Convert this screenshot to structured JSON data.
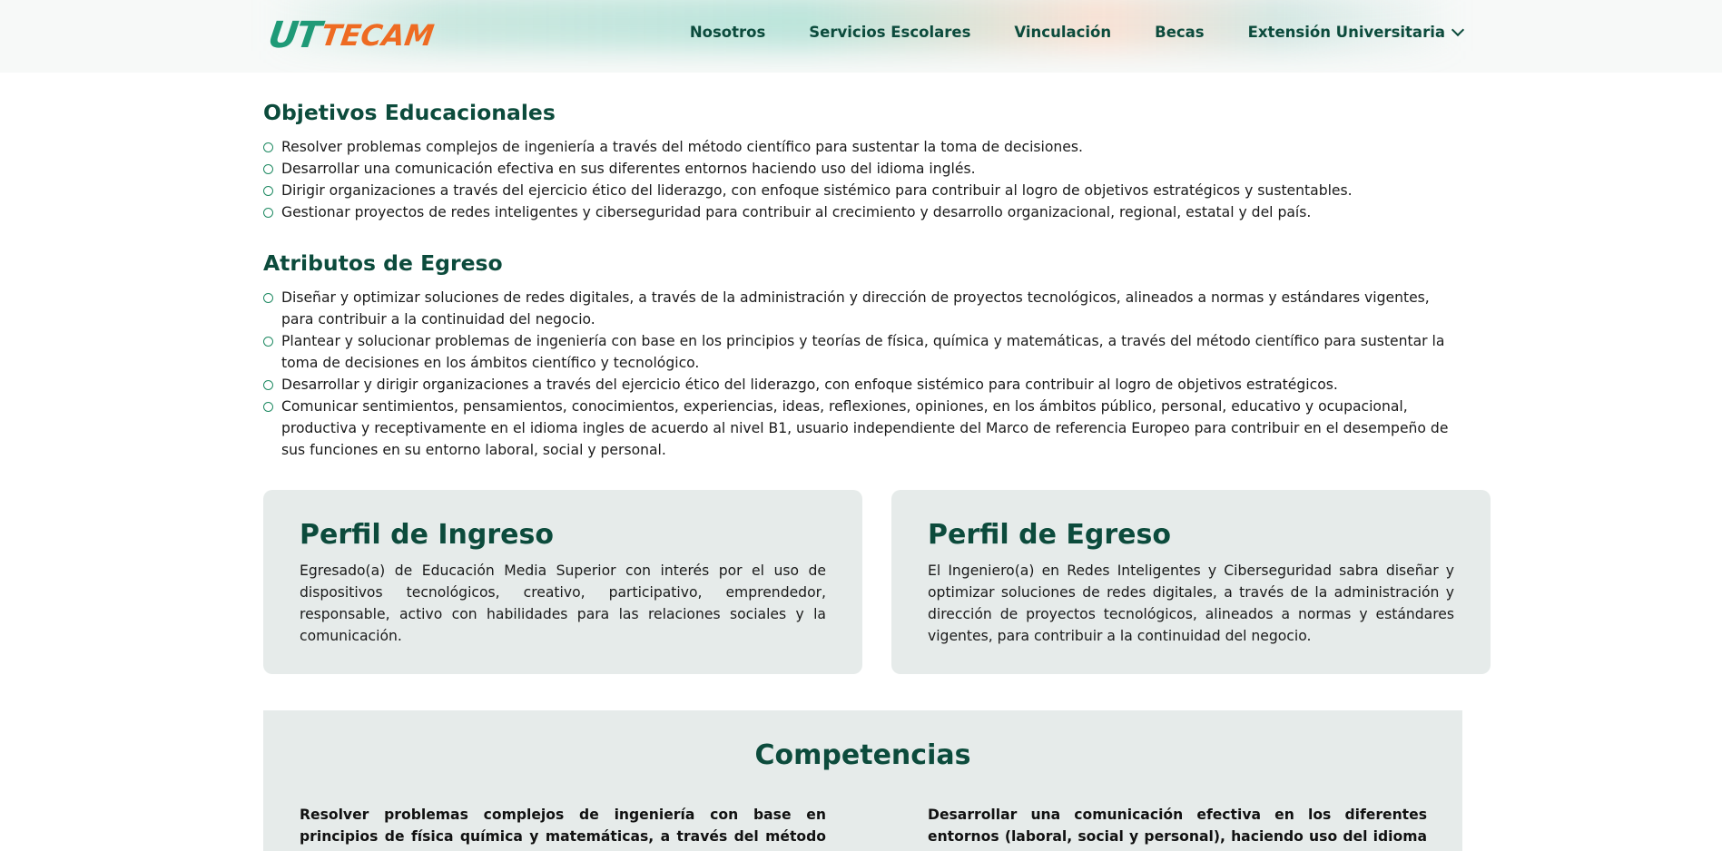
{
  "header": {
    "logo": {
      "part1": "UT",
      "part2": "TECAM"
    },
    "nav": [
      {
        "label": "Nosotros"
      },
      {
        "label": "Servicios Escolares"
      },
      {
        "label": "Vinculación"
      },
      {
        "label": "Becas"
      },
      {
        "label": "Extensión Universitaria",
        "has_dropdown": true
      }
    ]
  },
  "objetivos": {
    "title": "Objetivos Educacionales",
    "items": [
      "Resolver problemas complejos de ingeniería a través del método científico para sustentar la toma de decisiones.",
      "Desarrollar una comunicación efectiva en sus diferentes entornos haciendo uso del idioma inglés.",
      "Dirigir organizaciones a través del ejercicio ético del liderazgo, con enfoque sistémico para contribuir al logro de objetivos estratégicos y sustentables.",
      "Gestionar proyectos de redes inteligentes y ciberseguridad para contribuir al crecimiento y desarrollo organizacional, regional, estatal y del país."
    ]
  },
  "atributos": {
    "title": "Atributos de Egreso",
    "items": [
      "Diseñar y optimizar soluciones de redes digitales, a través de la administración y dirección de proyectos tecnológicos, alineados a normas y estándares vigentes, para contribuir a la continuidad del negocio.",
      "Plantear y solucionar problemas de ingeniería con base en los principios y teorías de física, química y matemáticas, a través del método científico para sustentar la toma de decisiones en los ámbitos científico y tecnológico.",
      "Desarrollar y dirigir organizaciones a través del ejercicio ético del liderazgo, con enfoque sistémico para contribuir al logro de objetivos estratégicos.",
      "Comunicar sentimientos, pensamientos, conocimientos, experiencias, ideas, reflexiones, opiniones, en los ámbitos público, personal, educativo y ocupacional, productiva y receptivamente en el idioma ingles de acuerdo al nivel B1, usuario independiente del Marco de referencia Europeo para contribuir en el desempeño de sus funciones en su entorno laboral, social y personal."
    ]
  },
  "perfil_ingreso": {
    "title": "Perfil de Ingreso",
    "text": "Egresado(a) de Educación Media Superior con interés por el uso de dispositivos tecnológicos, creativo, participativo, emprendedor, responsable, activo con habilidades para las relaciones sociales y la comunicación."
  },
  "perfil_egreso": {
    "title": "Perfil de Egreso",
    "text": "El Ingeniero(a) en Redes Inteligentes y Ciberseguridad sabra diseñar y optimizar soluciones de redes digitales, a través de la administración y dirección de proyectos tecnológicos, alineados a normas y estándares vigentes, para contribuir a la continuidad del negocio."
  },
  "competencias": {
    "title": "Competencias",
    "col1": "Resolver problemas complejos de ingeniería con base en principios de física química y matemáticas, a través del método científico para",
    "col2": "Desarrollar una comunicación efectiva en los diferentes entornos (laboral, social y personal), haciendo uso del idioma inglés,"
  }
}
